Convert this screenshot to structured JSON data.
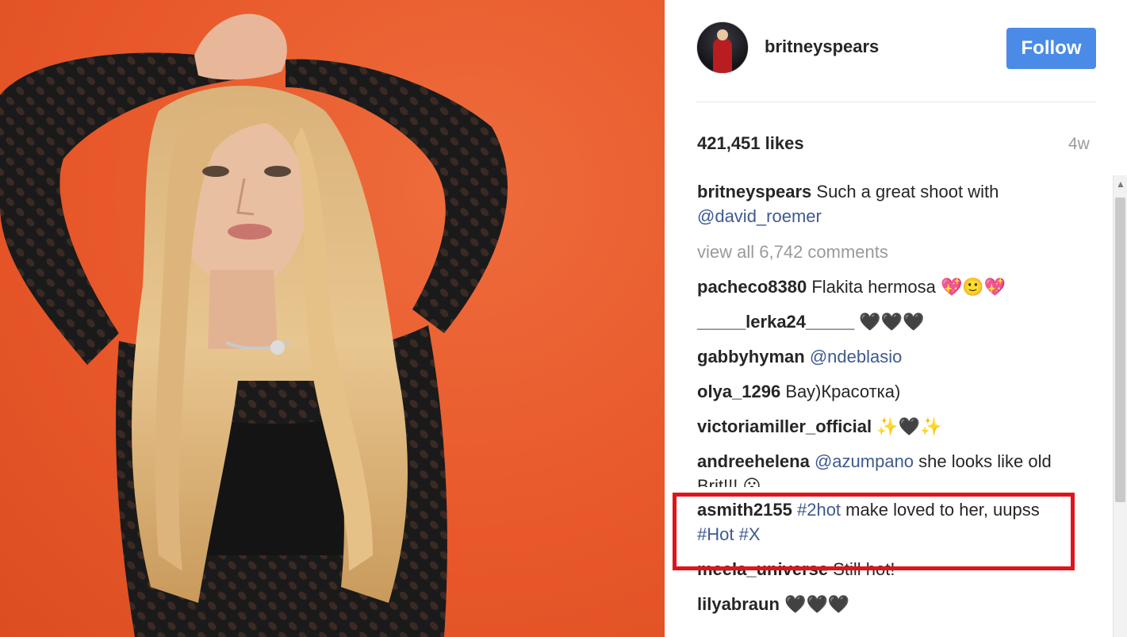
{
  "post": {
    "author": "britneyspears",
    "follow_label": "Follow",
    "likes": "421,451 likes",
    "time": "4w",
    "caption_user": "britneyspears",
    "caption_text": "Such a great shoot with",
    "caption_mention": "@david_roemer",
    "view_all": "view all 6,742 comments"
  },
  "comments": [
    {
      "user": "pacheco8380",
      "text": "Flakita hermosa 💖🙂💖"
    },
    {
      "user": "_____lerka24_____",
      "text": "🖤🖤🖤"
    },
    {
      "user": "gabbyhyman",
      "mention": "@ndeblasio"
    },
    {
      "user": "olya_1296",
      "text": "Вау)Красотка)"
    },
    {
      "user": "victoriamiller_official",
      "text": "✨🖤✨"
    },
    {
      "user": "andreehelena",
      "mention": "@azumpano",
      "text": "she looks like old Brit!!! 😮"
    },
    {
      "user": "asmith2155",
      "tag1": "#2hot",
      "text": "make loved to her, uupss",
      "tag2": "#Hot",
      "tag3": "#X"
    },
    {
      "user": "meela_universe",
      "text": "Still hot!"
    },
    {
      "user": "lilyabraun",
      "text": "🖤🖤🖤"
    }
  ],
  "colors": {
    "photo_background": "#e8582a",
    "follow_button": "#4a8be8",
    "mention_link": "#3e5a8f",
    "highlight_border": "#e0141c"
  },
  "icons": {
    "scroll_up": "chevron-up-icon"
  }
}
